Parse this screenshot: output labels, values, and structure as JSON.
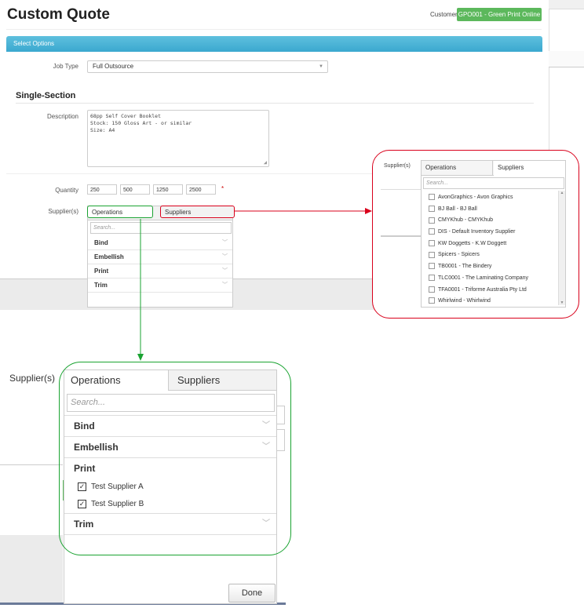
{
  "header": {
    "title": "Custom Quote",
    "customer_label": "Customer",
    "customer_value": "GPO001 - Green Print Online"
  },
  "banner": {
    "label": "Select Options"
  },
  "form": {
    "job_type_label": "Job Type",
    "job_type_value": "Full Outsource",
    "section_title": "Single-Section",
    "description_label": "Description",
    "description_lines": [
      "68pp Self Cover Booklet",
      "Stock: 150 Gloss Art - or similar",
      "Size: A4"
    ],
    "quantity_label": "Quantity",
    "quantities": [
      "250",
      "500",
      "1250",
      "2500"
    ],
    "required_mark": "*",
    "suppliers_label": "Supplier(s)"
  },
  "small_panel": {
    "tab_operations": "Operations",
    "tab_suppliers": "Suppliers",
    "search_placeholder": "Search...",
    "operations": [
      "Bind",
      "Embellish",
      "Print",
      "Trim"
    ]
  },
  "supplier_panel": {
    "label": "Supplier(s)",
    "tab_operations": "Operations",
    "tab_suppliers": "Suppliers",
    "search_placeholder": "Search...",
    "suppliers": [
      "AvonGraphics - Avon Graphics",
      "BJ Ball - BJ Ball",
      "CMYKhub - CMYKhub",
      "DIS - Default Inventory Supplier",
      "KW Doggetts - K.W Doggett",
      "Spicers - Spicers",
      "TB0001 - The Bindery",
      "TLC0001 - The Laminating Company",
      "TFA0001 - Triforme Australia Pty Ltd",
      "Whirlwind - Whirlwind"
    ]
  },
  "zoom_panel": {
    "label": "Supplier(s)",
    "tab_operations": "Operations",
    "tab_suppliers": "Suppliers",
    "search_placeholder": "Search...",
    "rows": [
      "Bind",
      "Embellish",
      "Print"
    ],
    "print_suppliers": [
      "Test Supplier A",
      "Test Supplier B"
    ],
    "trim": "Trim",
    "done_label": "Done"
  },
  "colors": {
    "green": "#5cb85c",
    "red": "#d9001b",
    "callout_green": "#1aa331",
    "banner": "#4ab4d8"
  }
}
